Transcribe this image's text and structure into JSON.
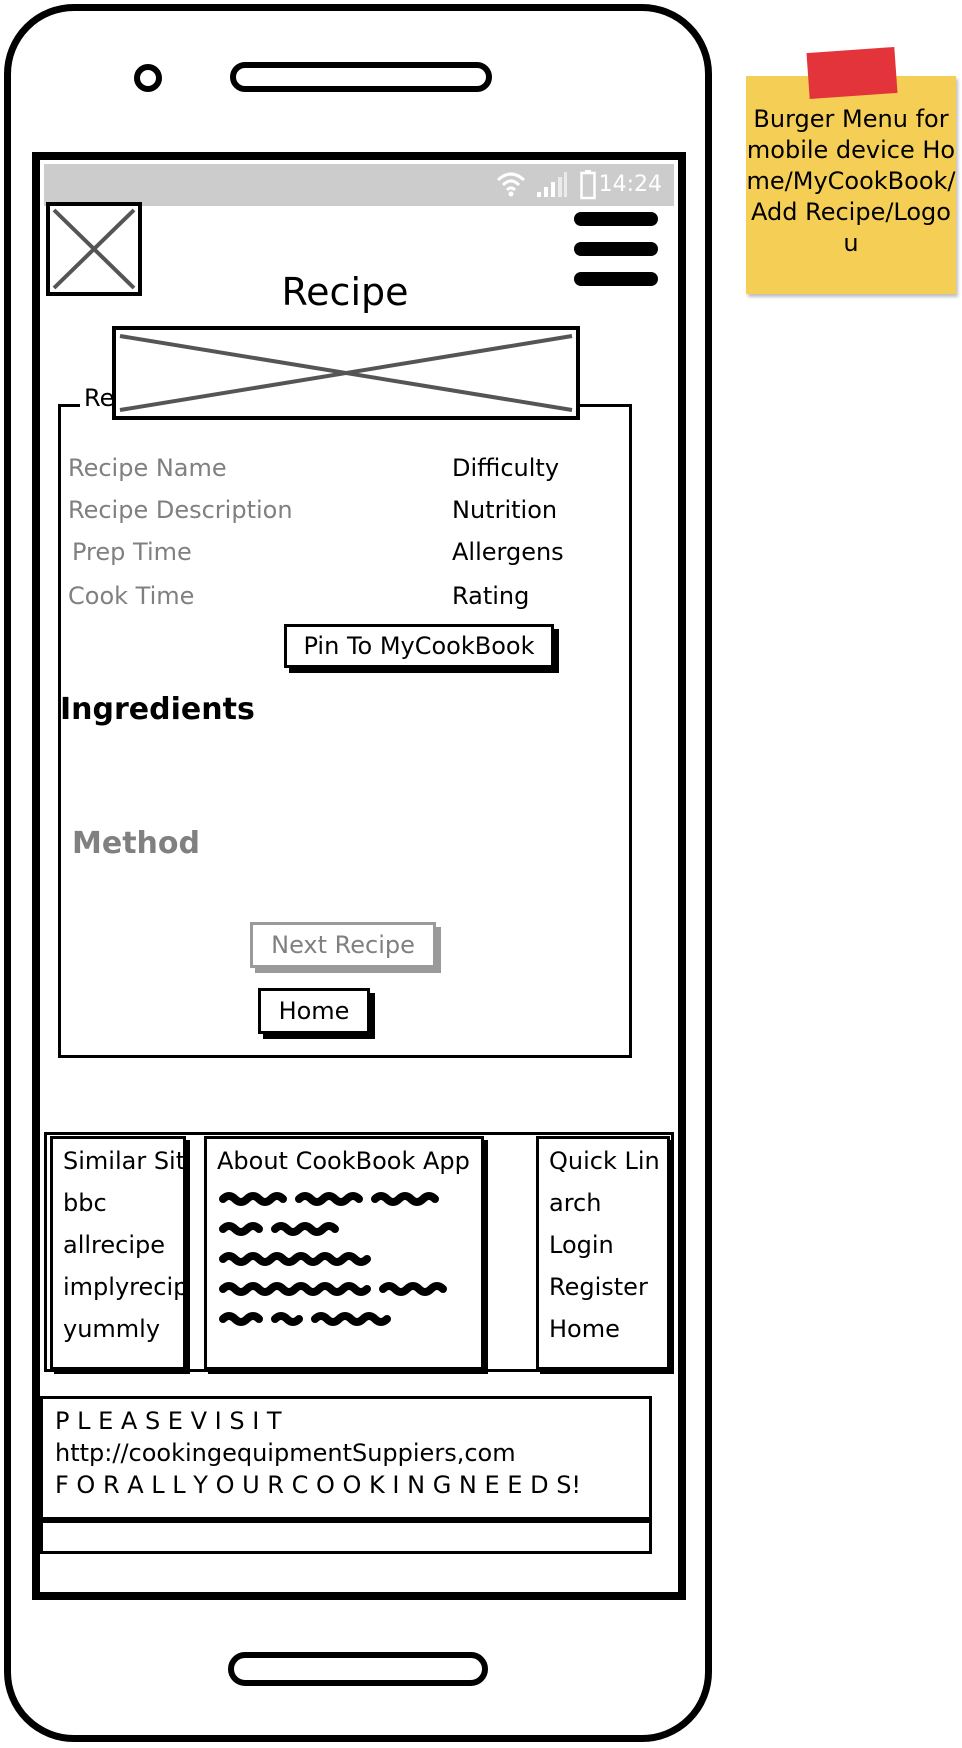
{
  "status_bar": {
    "time": "14:24"
  },
  "header": {
    "title": "Recipe",
    "menu_icon": "burger-menu-icon",
    "logo_icon": "image-placeholder-icon"
  },
  "recipe": {
    "panel_label": "Re",
    "fields_left": [
      "Recipe Name",
      "Recipe Description",
      "Prep Time",
      "Cook Time"
    ],
    "fields_right": [
      "Difficulty",
      "Nutrition",
      "Allergens",
      "Rating"
    ],
    "pin_button": "Pin To MyCookBook",
    "ingredients_heading": "Ingredients",
    "method_heading": "Method",
    "next_button": "Next Recipe",
    "home_button": "Home"
  },
  "footer": {
    "similar_sites": {
      "title": "Similar Sit",
      "items": [
        "bbc",
        "allrecipe",
        "implyrecip",
        "yummly"
      ]
    },
    "about": {
      "title": "About CookBook App"
    },
    "quick_links": {
      "title": "Quick Lin",
      "items": [
        "arch",
        "Login",
        "Register",
        "Home"
      ]
    }
  },
  "advert": {
    "line1": "P L E A S E  V I S I T",
    "line2": "http://cookingequipmentSuppiers,com",
    "line3": "F O R  A L L  Y O U R  C O O K I N G   N E E D S!"
  },
  "sticky_note": {
    "text": "Burger Menu for mobile device Home/MyCookBook/Add Recipe/Logou"
  },
  "colors": {
    "status_bar": "#cccccc",
    "sticky": "#f5cf55",
    "tape": "#e2343a",
    "muted_text": "#808080"
  }
}
